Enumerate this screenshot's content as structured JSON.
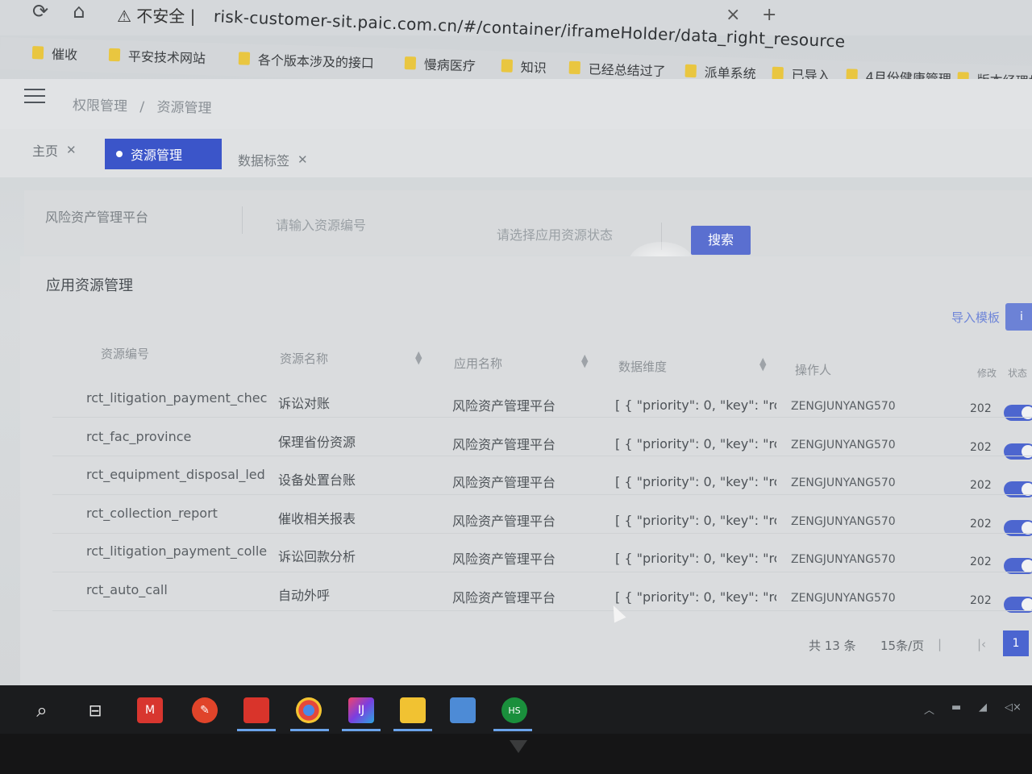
{
  "browser": {
    "security_warning": "不安全",
    "url": "risk-customer-sit.paic.com.cn/#/container/iframeHolder/data_right_resource",
    "close_tab": "×",
    "new_tab": "+"
  },
  "bookmarks": [
    "催收",
    "平安技术网站",
    "各个版本涉及的接口",
    "慢病医疗",
    "知识",
    "已经总结过了",
    "派单系统",
    "已导入",
    "4月份健康管理",
    "版本经理相"
  ],
  "header": {
    "breadcrumb_root": "权限管理",
    "breadcrumb_sep": "/",
    "breadcrumb_current": "资源管理"
  },
  "tabs": [
    {
      "label": "主页",
      "active": false
    },
    {
      "label": "资源管理",
      "active": true
    },
    {
      "label": "数据标签",
      "active": false
    }
  ],
  "search": {
    "platform_value": "风险资产管理平台",
    "code_placeholder": "请输入资源编号",
    "status_placeholder": "请选择应用资源状态",
    "button": "搜索"
  },
  "panel": {
    "title": "应用资源管理",
    "import_template": "导入模板",
    "action_button": "i"
  },
  "table": {
    "columns": [
      "资源编号",
      "资源名称",
      "应用名称",
      "数据维度",
      "操作人",
      "修改",
      "状态"
    ],
    "rows": [
      {
        "code": "rct_litigation_payment_chec",
        "name": "诉讼对账",
        "app": "风险资产管理平台",
        "dim": "[ { \"priority\": 0, \"key\": \"rct...",
        "operator": "ZENGJUNYANG570",
        "modified": "202",
        "status": true
      },
      {
        "code": "rct_fac_province",
        "name": "保理省份资源",
        "app": "风险资产管理平台",
        "dim": "[ { \"priority\": 0, \"key\": \"rct...",
        "operator": "ZENGJUNYANG570",
        "modified": "202",
        "status": true
      },
      {
        "code": "rct_equipment_disposal_led",
        "name": "设备处置台账",
        "app": "风险资产管理平台",
        "dim": "[ { \"priority\": 0, \"key\": \"rct...",
        "operator": "ZENGJUNYANG570",
        "modified": "202",
        "status": true
      },
      {
        "code": "rct_collection_report",
        "name": "催收相关报表",
        "app": "风险资产管理平台",
        "dim": "[ { \"priority\": 0, \"key\": \"rct...",
        "operator": "ZENGJUNYANG570",
        "modified": "202",
        "status": true
      },
      {
        "code": "rct_litigation_payment_colle",
        "name": "诉讼回款分析",
        "app": "风险资产管理平台",
        "dim": "[ { \"priority\": 0, \"key\": \"rct...",
        "operator": "ZENGJUNYANG570",
        "modified": "202",
        "status": true
      },
      {
        "code": "rct_auto_call",
        "name": "自动外呼",
        "app": "风险资产管理平台",
        "dim": "[ { \"priority\": 0, \"key\": \"rct...",
        "operator": "ZENGJUNYANG570",
        "modified": "202",
        "status": true
      }
    ]
  },
  "pagination": {
    "total": "共 13 条",
    "page_size": "15条/页",
    "current_page": "1"
  },
  "taskbar": {
    "apps": [
      "search-icon",
      "task-view-icon",
      "mail-icon",
      "pen-icon",
      "app-icon",
      "chrome-icon",
      "intellij-icon",
      "explorer-icon",
      "book-icon",
      "hs-icon"
    ],
    "hs_label": "HS",
    "mail_label": "M"
  },
  "colors": {
    "accent": "#3b55c9",
    "toggle": "#4d66cf",
    "folder": "#e9c640"
  }
}
